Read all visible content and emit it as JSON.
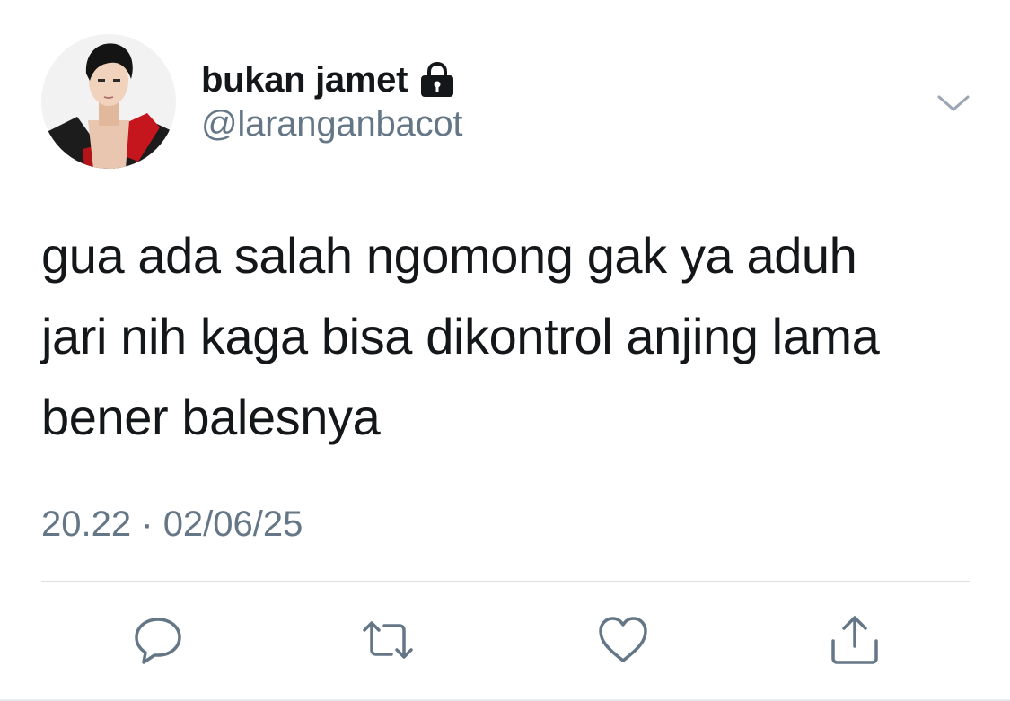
{
  "tweet": {
    "user": {
      "display_name": "bukan jamet",
      "handle": "@laranganbacot",
      "protected": true
    },
    "text": "gua ada salah ngomong gak ya aduh\njari nih kaga bisa dikontrol anjing lama\nbener balesnya",
    "time": "20.22",
    "separator": "·",
    "date": "02/06/25",
    "actions": [
      {
        "name": "reply",
        "icon": "speech-bubble-icon"
      },
      {
        "name": "retweet",
        "icon": "retweet-icon"
      },
      {
        "name": "like",
        "icon": "heart-icon"
      },
      {
        "name": "share",
        "icon": "share-icon"
      }
    ],
    "menu_icon": "chevron-down-icon",
    "colors": {
      "text": "#14171a",
      "secondary": "#657786",
      "divider": "#dcdfe2"
    }
  }
}
